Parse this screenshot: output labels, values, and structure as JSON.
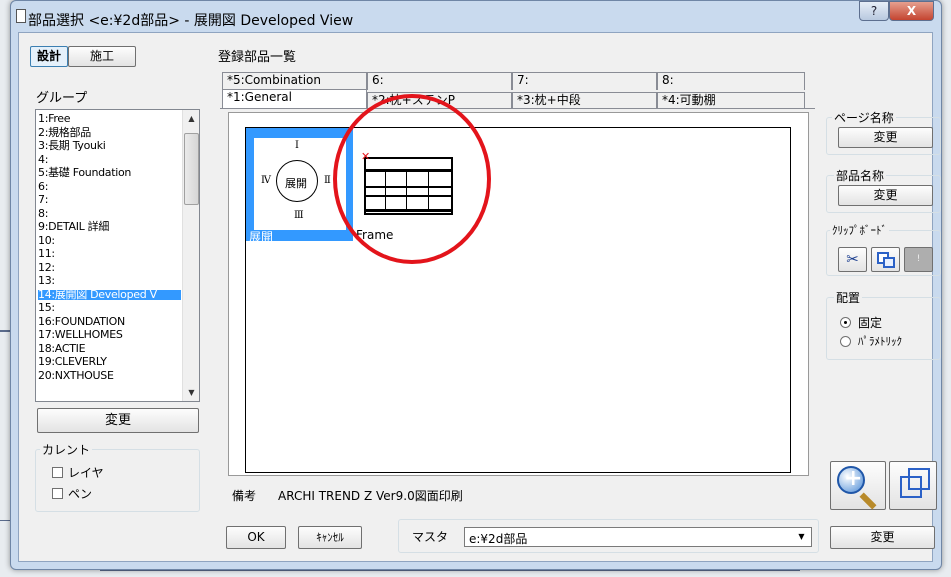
{
  "window": {
    "title": "部品選択 <e:¥2d部品> - 展開図 Developed View",
    "help_label": "?",
    "close_label": "X"
  },
  "mode_tabs": {
    "design": "設計",
    "construction": "施工"
  },
  "group": {
    "label": "グループ",
    "items": [
      "1:Free",
      "2:規格部品",
      "3:長期 Tyouki",
      "4:",
      "5:基礎 Foundation",
      "6:",
      "7:",
      "8:",
      "9:DETAIL 詳細",
      "10:",
      "11:",
      "12:",
      "13:",
      "14:展開図 Developed V",
      "15:",
      "16:FOUNDATION",
      "17:WELLHOMES",
      "18:ACTIE",
      "19:CLEVERLY",
      "20:NXTHOUSE"
    ],
    "selected_index": 13,
    "change_button": "変更"
  },
  "current": {
    "label": "カレント",
    "layer": "レイヤ",
    "pen": "ペン"
  },
  "registered": {
    "label": "登録部品一覧",
    "tabs_back": [
      "*5:Combination",
      "6:",
      "7:",
      "8:"
    ],
    "tabs_front": [
      "*1:General",
      "*2:枕+ステンP",
      "*3:枕+中段",
      "*4:可動棚"
    ],
    "cells": [
      {
        "label": "展開",
        "selected": true,
        "icon": "developed-view-symbol"
      },
      {
        "label": "Frame",
        "selected": false,
        "icon": "frame-drawing-thumbnail"
      }
    ],
    "symbol_letters": {
      "top": "Ⅰ",
      "left": "Ⅳ",
      "center": "展開",
      "right": "Ⅱ",
      "bottom": "Ⅲ"
    }
  },
  "remarks": {
    "label": "備考",
    "value": "ARCHI TREND Z Ver9.0図面印刷"
  },
  "right_panel": {
    "page_name": {
      "label": "ページ名称",
      "button": "変更"
    },
    "part_name": {
      "label": "部品名称",
      "button": "変更"
    },
    "clipboard": {
      "label": "ｸﾘｯﾌﾟﾎﾞｰﾄﾞ"
    },
    "placement": {
      "label": "配置",
      "fixed": "固定",
      "parametric": "ﾊﾟﾗﾒﾄﾘｯｸ",
      "selected": "fixed"
    }
  },
  "footer": {
    "ok": "OK",
    "cancel": "ｷｬﾝｾﾙ",
    "master_label": "マスタ",
    "master_value": "e:¥2d部品",
    "change": "変更"
  },
  "colors": {
    "selection": "#3399ff",
    "annotation": "#e3141b"
  }
}
